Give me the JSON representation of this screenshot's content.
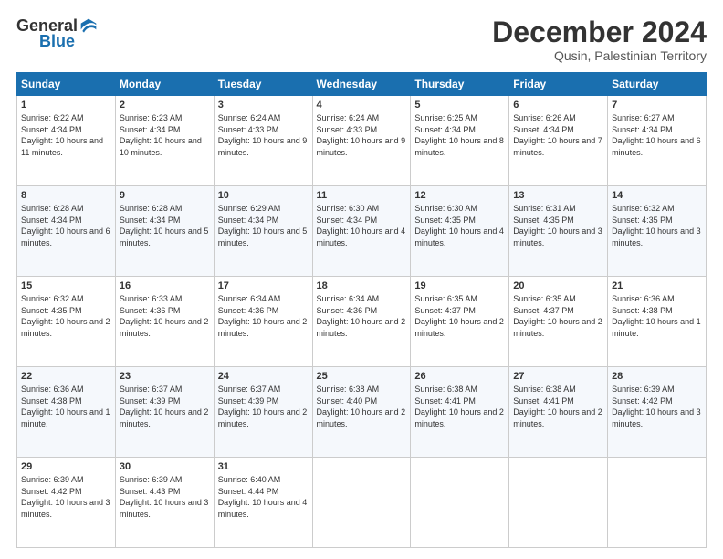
{
  "header": {
    "logo_general": "General",
    "logo_blue": "Blue",
    "month": "December 2024",
    "location": "Qusin, Palestinian Territory"
  },
  "days_of_week": [
    "Sunday",
    "Monday",
    "Tuesday",
    "Wednesday",
    "Thursday",
    "Friday",
    "Saturday"
  ],
  "weeks": [
    [
      {
        "day": "1",
        "sunrise": "6:22 AM",
        "sunset": "4:34 PM",
        "daylight": "10 hours and 11 minutes."
      },
      {
        "day": "2",
        "sunrise": "6:23 AM",
        "sunset": "4:34 PM",
        "daylight": "10 hours and 10 minutes."
      },
      {
        "day": "3",
        "sunrise": "6:24 AM",
        "sunset": "4:33 PM",
        "daylight": "10 hours and 9 minutes."
      },
      {
        "day": "4",
        "sunrise": "6:24 AM",
        "sunset": "4:33 PM",
        "daylight": "10 hours and 9 minutes."
      },
      {
        "day": "5",
        "sunrise": "6:25 AM",
        "sunset": "4:34 PM",
        "daylight": "10 hours and 8 minutes."
      },
      {
        "day": "6",
        "sunrise": "6:26 AM",
        "sunset": "4:34 PM",
        "daylight": "10 hours and 7 minutes."
      },
      {
        "day": "7",
        "sunrise": "6:27 AM",
        "sunset": "4:34 PM",
        "daylight": "10 hours and 6 minutes."
      }
    ],
    [
      {
        "day": "8",
        "sunrise": "6:28 AM",
        "sunset": "4:34 PM",
        "daylight": "10 hours and 6 minutes."
      },
      {
        "day": "9",
        "sunrise": "6:28 AM",
        "sunset": "4:34 PM",
        "daylight": "10 hours and 5 minutes."
      },
      {
        "day": "10",
        "sunrise": "6:29 AM",
        "sunset": "4:34 PM",
        "daylight": "10 hours and 5 minutes."
      },
      {
        "day": "11",
        "sunrise": "6:30 AM",
        "sunset": "4:34 PM",
        "daylight": "10 hours and 4 minutes."
      },
      {
        "day": "12",
        "sunrise": "6:30 AM",
        "sunset": "4:35 PM",
        "daylight": "10 hours and 4 minutes."
      },
      {
        "day": "13",
        "sunrise": "6:31 AM",
        "sunset": "4:35 PM",
        "daylight": "10 hours and 3 minutes."
      },
      {
        "day": "14",
        "sunrise": "6:32 AM",
        "sunset": "4:35 PM",
        "daylight": "10 hours and 3 minutes."
      }
    ],
    [
      {
        "day": "15",
        "sunrise": "6:32 AM",
        "sunset": "4:35 PM",
        "daylight": "10 hours and 2 minutes."
      },
      {
        "day": "16",
        "sunrise": "6:33 AM",
        "sunset": "4:36 PM",
        "daylight": "10 hours and 2 minutes."
      },
      {
        "day": "17",
        "sunrise": "6:34 AM",
        "sunset": "4:36 PM",
        "daylight": "10 hours and 2 minutes."
      },
      {
        "day": "18",
        "sunrise": "6:34 AM",
        "sunset": "4:36 PM",
        "daylight": "10 hours and 2 minutes."
      },
      {
        "day": "19",
        "sunrise": "6:35 AM",
        "sunset": "4:37 PM",
        "daylight": "10 hours and 2 minutes."
      },
      {
        "day": "20",
        "sunrise": "6:35 AM",
        "sunset": "4:37 PM",
        "daylight": "10 hours and 2 minutes."
      },
      {
        "day": "21",
        "sunrise": "6:36 AM",
        "sunset": "4:38 PM",
        "daylight": "10 hours and 1 minute."
      }
    ],
    [
      {
        "day": "22",
        "sunrise": "6:36 AM",
        "sunset": "4:38 PM",
        "daylight": "10 hours and 1 minute."
      },
      {
        "day": "23",
        "sunrise": "6:37 AM",
        "sunset": "4:39 PM",
        "daylight": "10 hours and 2 minutes."
      },
      {
        "day": "24",
        "sunrise": "6:37 AM",
        "sunset": "4:39 PM",
        "daylight": "10 hours and 2 minutes."
      },
      {
        "day": "25",
        "sunrise": "6:38 AM",
        "sunset": "4:40 PM",
        "daylight": "10 hours and 2 minutes."
      },
      {
        "day": "26",
        "sunrise": "6:38 AM",
        "sunset": "4:41 PM",
        "daylight": "10 hours and 2 minutes."
      },
      {
        "day": "27",
        "sunrise": "6:38 AM",
        "sunset": "4:41 PM",
        "daylight": "10 hours and 2 minutes."
      },
      {
        "day": "28",
        "sunrise": "6:39 AM",
        "sunset": "4:42 PM",
        "daylight": "10 hours and 3 minutes."
      }
    ],
    [
      {
        "day": "29",
        "sunrise": "6:39 AM",
        "sunset": "4:42 PM",
        "daylight": "10 hours and 3 minutes."
      },
      {
        "day": "30",
        "sunrise": "6:39 AM",
        "sunset": "4:43 PM",
        "daylight": "10 hours and 3 minutes."
      },
      {
        "day": "31",
        "sunrise": "6:40 AM",
        "sunset": "4:44 PM",
        "daylight": "10 hours and 4 minutes."
      },
      null,
      null,
      null,
      null
    ]
  ]
}
